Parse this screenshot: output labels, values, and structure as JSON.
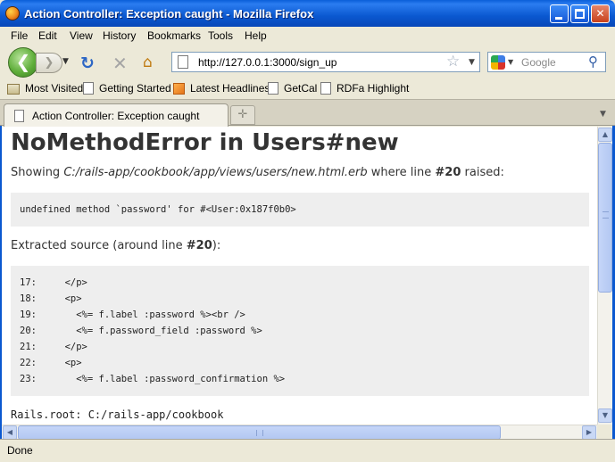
{
  "window": {
    "title": "Action Controller: Exception caught - Mozilla Firefox"
  },
  "menu": [
    {
      "label": "File"
    },
    {
      "label": "Edit"
    },
    {
      "label": "View"
    },
    {
      "label": "History"
    },
    {
      "label": "Bookmarks"
    },
    {
      "label": "Tools"
    },
    {
      "label": "Help"
    }
  ],
  "nav": {
    "url": "http://127.0.0.1:3000/sign_up",
    "search_placeholder": "Google"
  },
  "bookmarks": [
    {
      "label": "Most Visited",
      "icon": "bookmark-folder-icon"
    },
    {
      "label": "Getting Started",
      "icon": "page-icon"
    },
    {
      "label": "Latest Headlines",
      "icon": "rss-feed-icon"
    },
    {
      "label": "GetCal",
      "icon": "page-icon"
    },
    {
      "label": "RDFa Highlight",
      "icon": "page-icon"
    }
  ],
  "tabs": [
    {
      "label": "Action Controller: Exception caught",
      "active": true
    }
  ],
  "page": {
    "heading": "NoMethodError in Users#new",
    "showing_prefix": "Showing ",
    "showing_path": "C:/rails-app/cookbook/app/views/users/new.html.erb",
    "showing_mid": " where line ",
    "showing_line": "#20",
    "showing_suffix": " raised:",
    "error_message": "undefined method `password' for #<User:0x187f0b0>",
    "extracted_prefix": "Extracted source (around line ",
    "extracted_line": "#20",
    "extracted_suffix": "):",
    "source_lines": [
      "17:     </p>",
      "18:     <p>",
      "19:       <%= f.label :password %><br />",
      "20:       <%= f.password_field :password %>",
      "21:     </p>",
      "22:     <p>",
      "23:       <%= f.label :password_confirmation %>"
    ],
    "rails_root": "Rails.root: C:/rails-app/cookbook"
  },
  "status": {
    "text": "Done"
  },
  "colors": {
    "titlebar": "#0a58d0",
    "error_box": "#eeeeee",
    "back_button": "#5fae3a"
  }
}
